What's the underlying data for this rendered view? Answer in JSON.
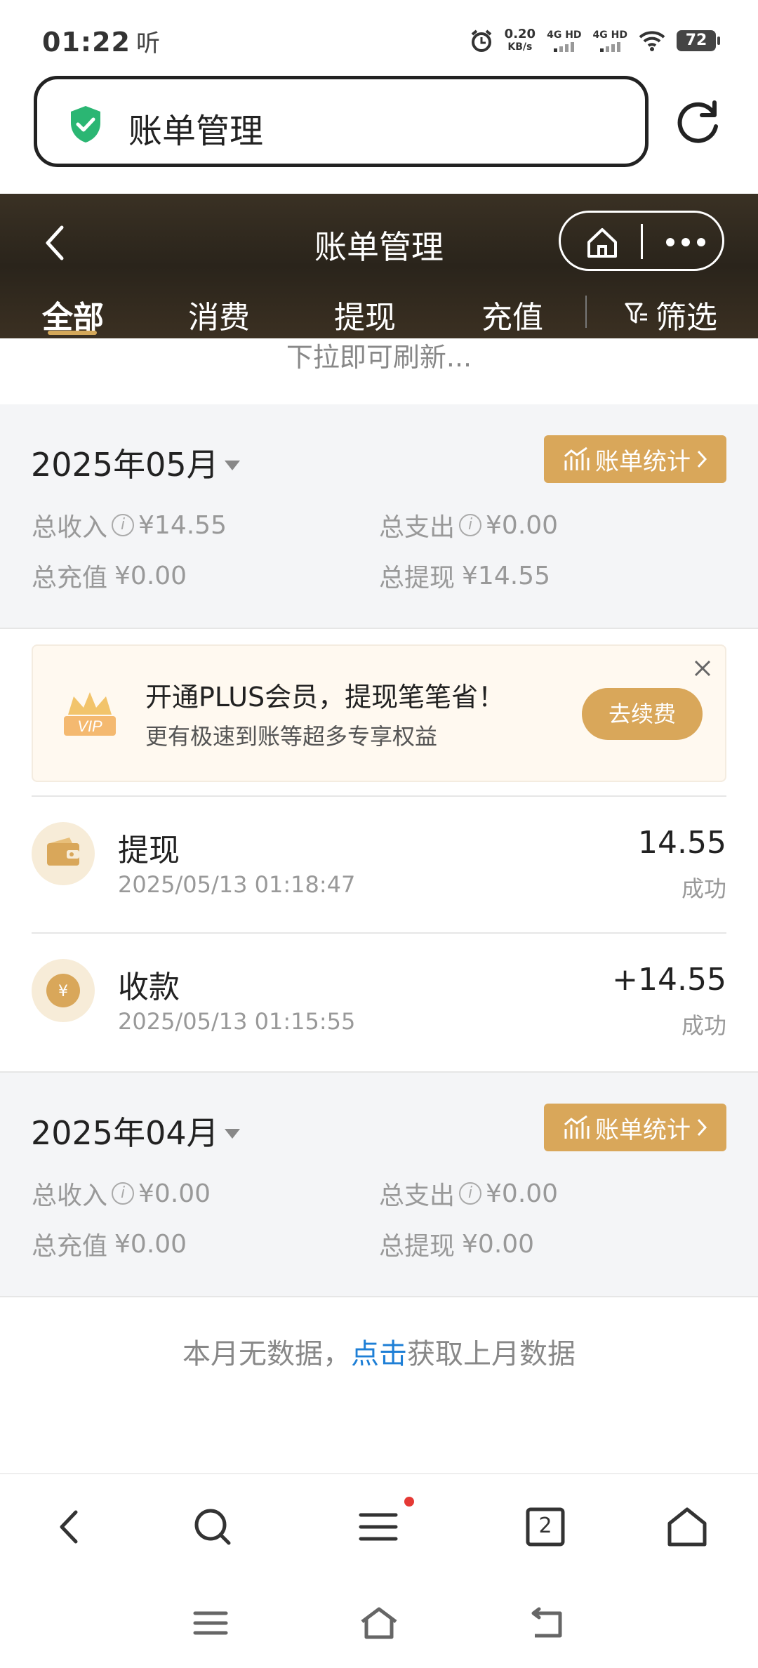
{
  "status_bar": {
    "time": "01:22",
    "time_suffix": "听",
    "net_speed_value": "0.20",
    "net_speed_unit": "KB/s",
    "signal1_label": "4G HD",
    "signal2_label": "4G HD",
    "battery": "72"
  },
  "address_bar": {
    "title": "账单管理"
  },
  "header": {
    "title": "账单管理",
    "tabs": [
      {
        "label": "全部",
        "active": true
      },
      {
        "label": "消费",
        "active": false
      },
      {
        "label": "提现",
        "active": false
      },
      {
        "label": "充值",
        "active": false
      }
    ],
    "filter_label": "筛选"
  },
  "pull_hint": "下拉即可刷新...",
  "months": [
    {
      "label": "2025年05月",
      "stat_button": "账单统计",
      "total_income_label": "总收入",
      "total_income": "¥14.55",
      "total_expense_label": "总支出",
      "total_expense": "¥0.00",
      "total_recharge_label": "总充值",
      "total_recharge": "¥0.00",
      "total_withdraw_label": "总提现",
      "total_withdraw": "¥14.55"
    },
    {
      "label": "2025年04月",
      "stat_button": "账单统计",
      "total_income_label": "总收入",
      "total_income": "¥0.00",
      "total_expense_label": "总支出",
      "total_expense": "¥0.00",
      "total_recharge_label": "总充值",
      "total_recharge": "¥0.00",
      "total_withdraw_label": "总提现",
      "total_withdraw": "¥0.00"
    }
  ],
  "promo": {
    "badge": "VIP",
    "title": "开通PLUS会员，提现笔笔省！",
    "subtitle": "更有极速到账等超多专享权益",
    "button": "去续费"
  },
  "transactions": [
    {
      "name": "提现",
      "time": "2025/05/13 01:18:47",
      "amount": "14.55",
      "status": "成功",
      "icon": "wallet-icon"
    },
    {
      "name": "收款",
      "time": "2025/05/13 01:15:55",
      "amount": "+14.55",
      "status": "成功",
      "icon": "yuan-coin-icon",
      "icon_symbol": "¥"
    }
  ],
  "no_data": {
    "prefix": "本月无数据，",
    "link": "点击",
    "suffix": "获取上月数据"
  },
  "bottom_nav": {
    "tab_count": "2"
  },
  "colors": {
    "accent_gold": "#d9a75a",
    "header_bg": "#2a241b",
    "link_blue": "#1e7fd6",
    "notification_dot": "#e53935"
  }
}
